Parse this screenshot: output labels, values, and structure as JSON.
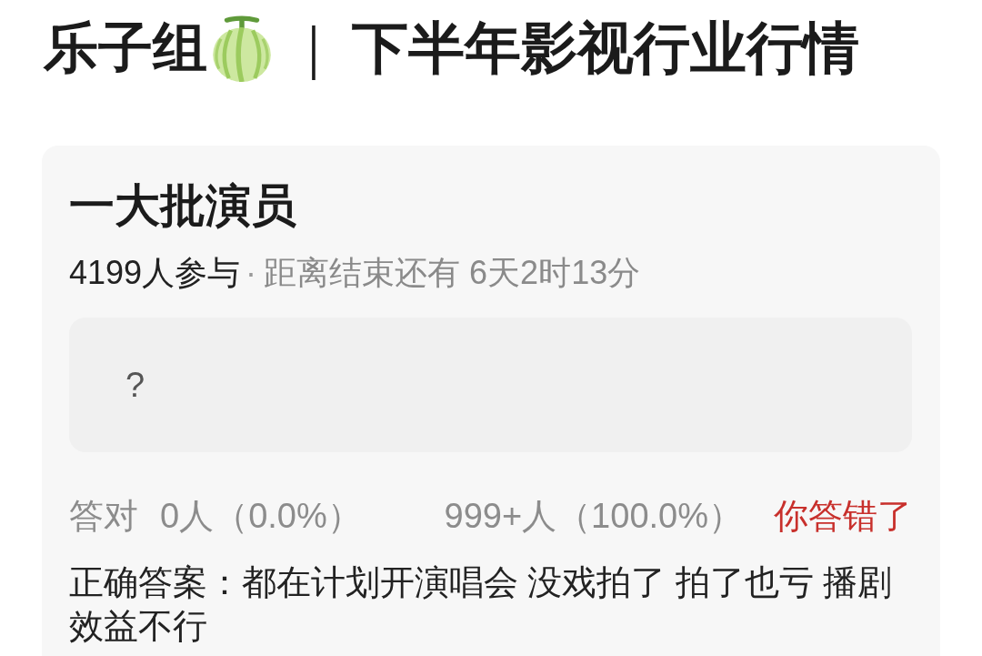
{
  "header": {
    "group": "乐子组",
    "separator": "｜",
    "topic": "下半年影视行业行情"
  },
  "poll": {
    "title": "一大批演员",
    "meta": {
      "participants": "4199人参与",
      "separator": "·",
      "countdown": "距离结束还有 6天2时13分"
    },
    "answer_box": {
      "text": "?"
    },
    "stats": {
      "correct_label": "答对",
      "correct_count": "0人（0.0%）",
      "wrong_count": "999+人（100.0%）"
    },
    "result": {
      "text": "你答错了",
      "correct": false
    },
    "correct_answer": "正确答案：都在计划开演唱会 没戏拍了 拍了也亏 播剧效益不行"
  }
}
